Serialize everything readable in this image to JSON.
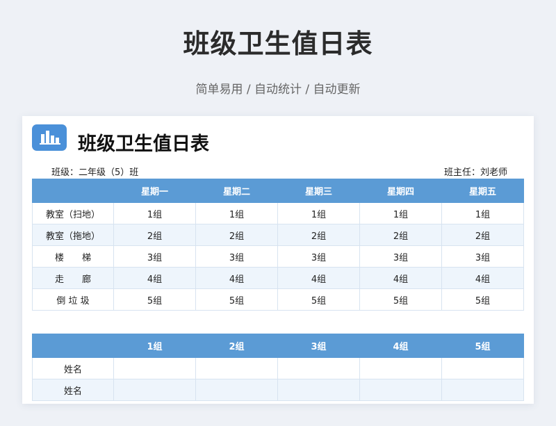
{
  "header": {
    "title": "班级卫生值日表",
    "subtitle": "简单易用 / 自动统计 / 自动更新"
  },
  "sheet": {
    "icon": "bar-chart-icon",
    "title": "班级卫生值日表",
    "class_info": "班级：二年级（5）班",
    "teacher_info": "班主任：刘老师"
  },
  "duty_table": {
    "columns": [
      "",
      "星期一",
      "星期二",
      "星期三",
      "星期四",
      "星期五"
    ],
    "rows": [
      {
        "area": "教室（扫地）",
        "cells": [
          "1组",
          "1组",
          "1组",
          "1组",
          "1组"
        ]
      },
      {
        "area": "教室（拖地）",
        "cells": [
          "2组",
          "2组",
          "2组",
          "2组",
          "2组"
        ]
      },
      {
        "area": "楼　　梯",
        "cells": [
          "3组",
          "3组",
          "3组",
          "3组",
          "3组"
        ]
      },
      {
        "area": "走　　廊",
        "cells": [
          "4组",
          "4组",
          "4组",
          "4组",
          "4组"
        ]
      },
      {
        "area": "倒 垃 圾",
        "cells": [
          "5组",
          "5组",
          "5组",
          "5组",
          "5组"
        ]
      }
    ]
  },
  "group_table": {
    "columns": [
      "",
      "1组",
      "2组",
      "3组",
      "4组",
      "5组"
    ],
    "rows": [
      {
        "label": "姓名",
        "cells": [
          "",
          "",
          "",
          "",
          ""
        ]
      },
      {
        "label": "姓名",
        "cells": [
          "",
          "",
          "",
          "",
          ""
        ]
      }
    ]
  },
  "colors": {
    "header_blue": "#5b9bd5",
    "logo_blue": "#4a90d9",
    "stripe": "#eef5fc",
    "background": "#eef1f6"
  }
}
